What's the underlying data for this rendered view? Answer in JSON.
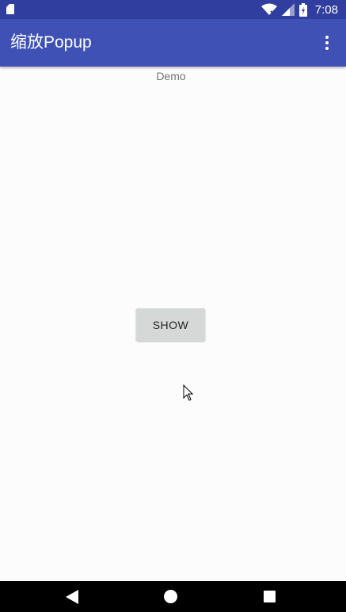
{
  "status_bar": {
    "time": "7:08",
    "icons": [
      "sd-card-icon",
      "wifi-icon",
      "signal-icon",
      "battery-icon"
    ]
  },
  "app_bar": {
    "title": "缩放Popup",
    "overflow_icon": "more-vert-icon"
  },
  "content": {
    "demo_label": "Demo",
    "show_button_label": "SHOW"
  },
  "nav_bar": {
    "icons": [
      "back-icon",
      "home-icon",
      "recents-icon"
    ]
  },
  "colors": {
    "status_bar": "#303f9f",
    "app_bar": "#3f51b5",
    "button": "#d6d7d7",
    "background": "#fcfcfc"
  }
}
